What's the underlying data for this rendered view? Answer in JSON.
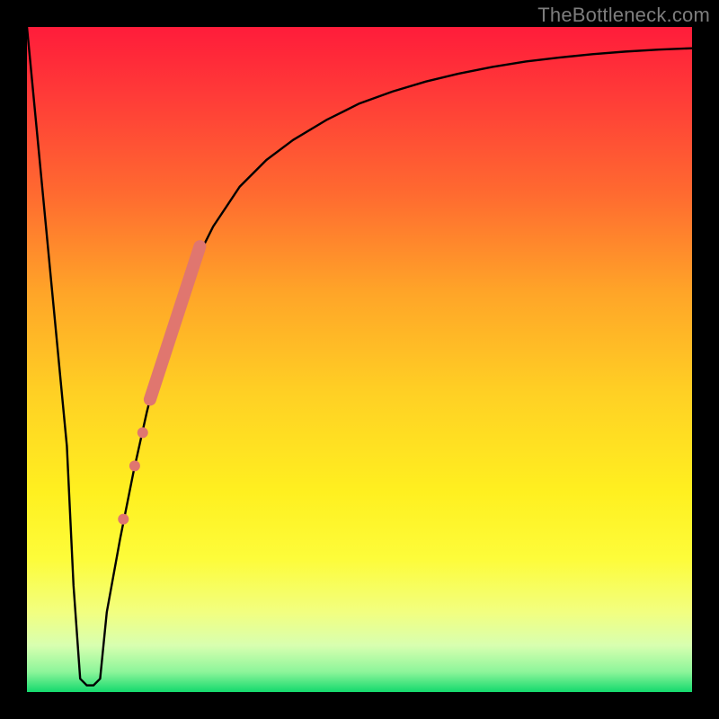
{
  "watermark": "TheBottleneck.com",
  "chart_data": {
    "type": "line",
    "title": "",
    "xlabel": "",
    "ylabel": "",
    "xlim": [
      0,
      100
    ],
    "ylim": [
      0,
      100
    ],
    "grid": false,
    "legend": null,
    "background": "red-yellow-green vertical gradient",
    "series": [
      {
        "name": "bottleneck-curve",
        "stroke": "#000000",
        "x": [
          0,
          2,
          4,
          6,
          7,
          8,
          9,
          10,
          11,
          12,
          14,
          16,
          18,
          20,
          22,
          25,
          28,
          32,
          36,
          40,
          45,
          50,
          55,
          60,
          65,
          70,
          75,
          80,
          85,
          90,
          95,
          100
        ],
        "y": [
          100,
          79,
          58,
          37,
          16,
          2,
          1,
          1,
          2,
          12,
          23,
          33,
          42,
          50,
          57,
          64,
          70,
          76,
          80,
          83,
          86,
          88.5,
          90.3,
          91.8,
          93,
          94,
          94.8,
          95.4,
          95.9,
          96.3,
          96.6,
          96.8
        ]
      }
    ],
    "markers": [
      {
        "name": "highlight-dot-1",
        "shape": "circle",
        "color": "#e0766f",
        "x": 14.5,
        "y": 26,
        "r": 6
      },
      {
        "name": "highlight-dot-2",
        "shape": "circle",
        "color": "#e0766f",
        "x": 16.2,
        "y": 34,
        "r": 6
      },
      {
        "name": "highlight-dot-3",
        "shape": "circle",
        "color": "#e0766f",
        "x": 17.4,
        "y": 39,
        "r": 6
      },
      {
        "name": "highlight-bar",
        "shape": "segment",
        "color": "#e0766f",
        "x1": 18.5,
        "y1": 44,
        "x2": 26,
        "y2": 67,
        "width": 14
      }
    ]
  }
}
